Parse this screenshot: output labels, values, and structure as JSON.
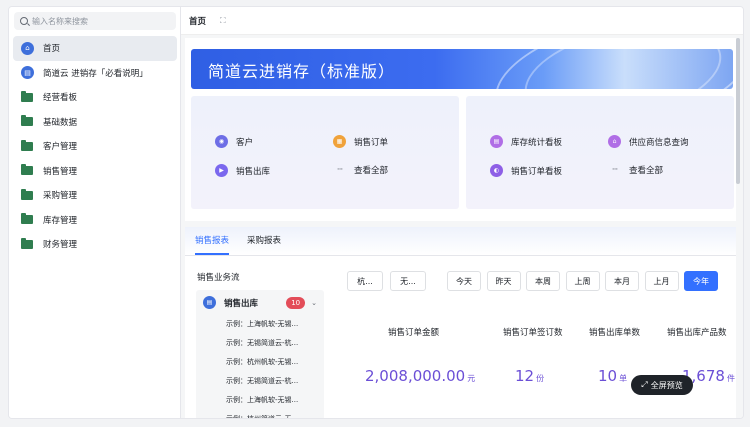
{
  "sidebar": {
    "search_placeholder": "输入名称来搜索",
    "items": [
      {
        "label": "首页",
        "icon": "home-icon"
      },
      {
        "label": "简道云 进销存「必看说明」",
        "icon": "doc-icon"
      },
      {
        "label": "经营看板",
        "icon": "folder-icon"
      },
      {
        "label": "基础数据",
        "icon": "folder-icon"
      },
      {
        "label": "客户管理",
        "icon": "folder-icon"
      },
      {
        "label": "销售管理",
        "icon": "folder-icon"
      },
      {
        "label": "采购管理",
        "icon": "folder-icon"
      },
      {
        "label": "库存管理",
        "icon": "folder-icon"
      },
      {
        "label": "财务管理",
        "icon": "folder-icon"
      }
    ]
  },
  "header": {
    "tab": "首页",
    "expand_icon": "⛶"
  },
  "banner": {
    "title": "简道云进销存（标准版）"
  },
  "quick_left": [
    {
      "label": "客户",
      "color": "#6e6ee6",
      "icon": "customer-icon"
    },
    {
      "label": "销售订单",
      "color": "#f0a23a",
      "icon": "order-icon"
    },
    {
      "label": "销售出库",
      "color": "#7b68ee",
      "icon": "outbound-icon"
    },
    {
      "label": "查看全部",
      "icon": "more-icon"
    }
  ],
  "quick_right": [
    {
      "label": "库存统计看板",
      "color": "#b06ee6",
      "icon": "stock-icon"
    },
    {
      "label": "供应商信息查询",
      "color": "#b06ee6",
      "icon": "supplier-icon"
    },
    {
      "label": "销售订单看板",
      "color": "#8e5fe6",
      "icon": "sales-board-icon"
    },
    {
      "label": "查看全部",
      "icon": "more-icon"
    }
  ],
  "report": {
    "tabs": [
      "销售报表",
      "采购报表"
    ],
    "flow_title": "销售业务流",
    "flow_head": {
      "label": "销售出库",
      "count": "10"
    },
    "flow_items": [
      "示例：上海帆软-无锡...",
      "示例：无锡简道云-杭...",
      "示例：杭州帆软-无锡...",
      "示例：无锡简道云-杭...",
      "示例：上海帆软-无锡...",
      "示例：杭州简道云-无..."
    ],
    "filters": [
      "杭...",
      "无..."
    ],
    "date_buttons": [
      "今天",
      "昨天",
      "本周",
      "上周",
      "本月",
      "上月",
      "今年"
    ],
    "stats": [
      {
        "label": "销售订单金额",
        "value": "2,008,000.00",
        "unit": "元"
      },
      {
        "label": "销售订单签订数",
        "value": "12",
        "unit": "份"
      },
      {
        "label": "销售出库单数",
        "value": "10",
        "unit": "单"
      },
      {
        "label": "销售出库产品数",
        "value": "1,678",
        "unit": "件"
      }
    ],
    "fullscreen_label": "全屏预览"
  }
}
